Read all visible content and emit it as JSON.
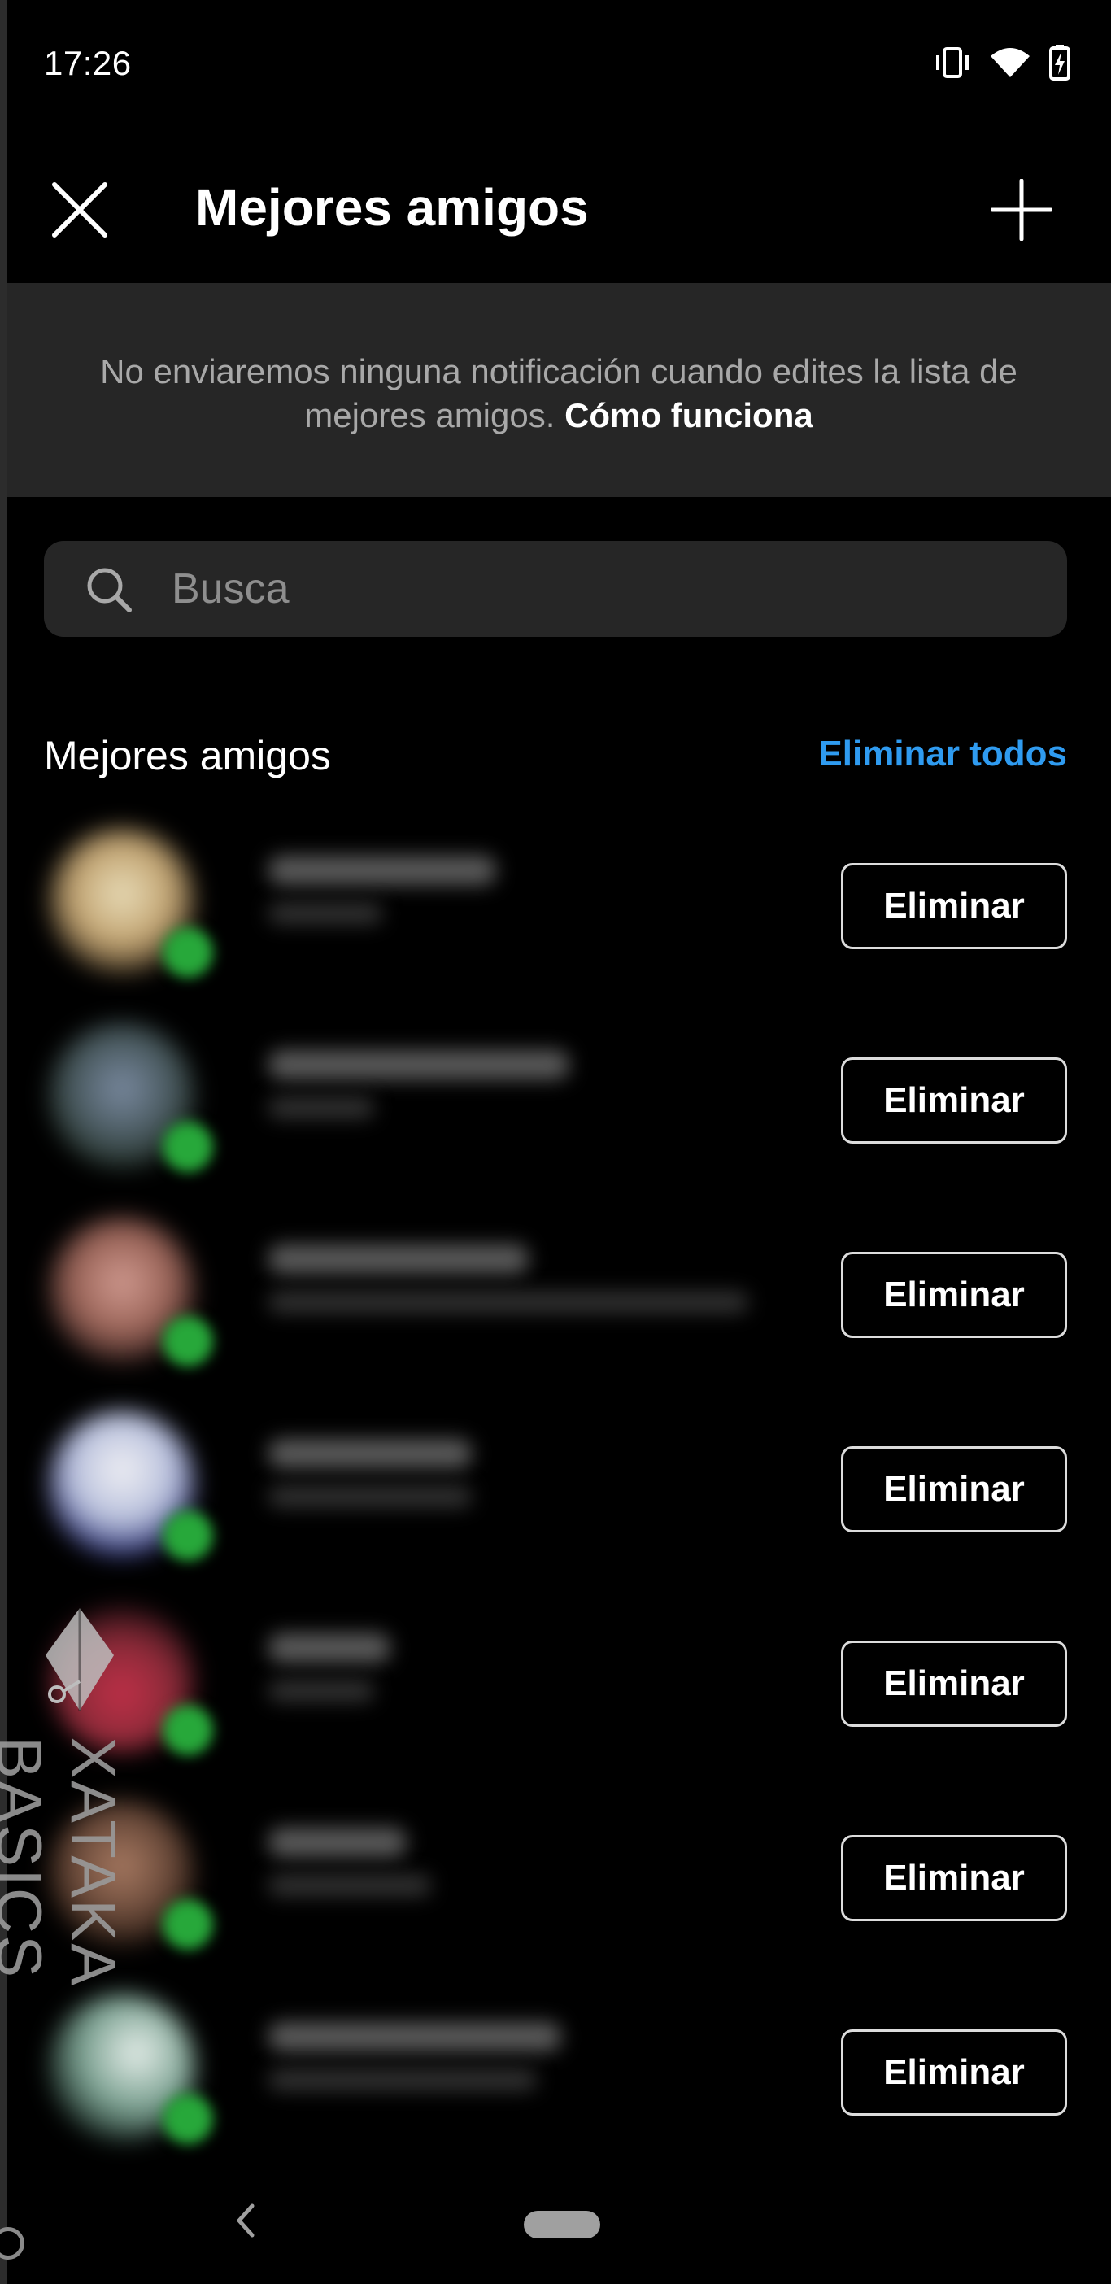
{
  "status_bar": {
    "time": "17:26",
    "icons": [
      "vibrate-icon",
      "wifi-icon",
      "battery-charging-icon"
    ]
  },
  "header": {
    "title": "Mejores amigos",
    "close_icon": "close-icon",
    "add_icon": "plus-icon"
  },
  "notice": {
    "text": "No enviaremos ninguna notificación cuando edites la lista de mejores amigos.",
    "link": "Cómo funciona"
  },
  "search": {
    "placeholder": "Busca",
    "icon": "search-icon"
  },
  "section": {
    "title": "Mejores amigos",
    "remove_all": "Eliminar todos"
  },
  "friends": [
    {
      "remove_label": "Eliminar",
      "avatar_color": "#d8c59a"
    },
    {
      "remove_label": "Eliminar",
      "avatar_color": "#5a6a7a"
    },
    {
      "remove_label": "Eliminar",
      "avatar_color": "#b87a70"
    },
    {
      "remove_label": "Eliminar",
      "avatar_color": "#c9cde0"
    },
    {
      "remove_label": "Eliminar",
      "avatar_color": "#a84050"
    },
    {
      "remove_label": "Eliminar",
      "avatar_color": "#8a6050"
    },
    {
      "remove_label": "Eliminar",
      "avatar_color": "#6a8a7a"
    }
  ],
  "watermark": {
    "text": "XATAKA BASICS"
  },
  "nav_bar": {
    "icons": [
      "back-icon",
      "home-pill-icon"
    ]
  },
  "colors": {
    "background": "#000000",
    "panel": "#262626",
    "accent": "#2f9bf0",
    "online": "#27a83a"
  }
}
